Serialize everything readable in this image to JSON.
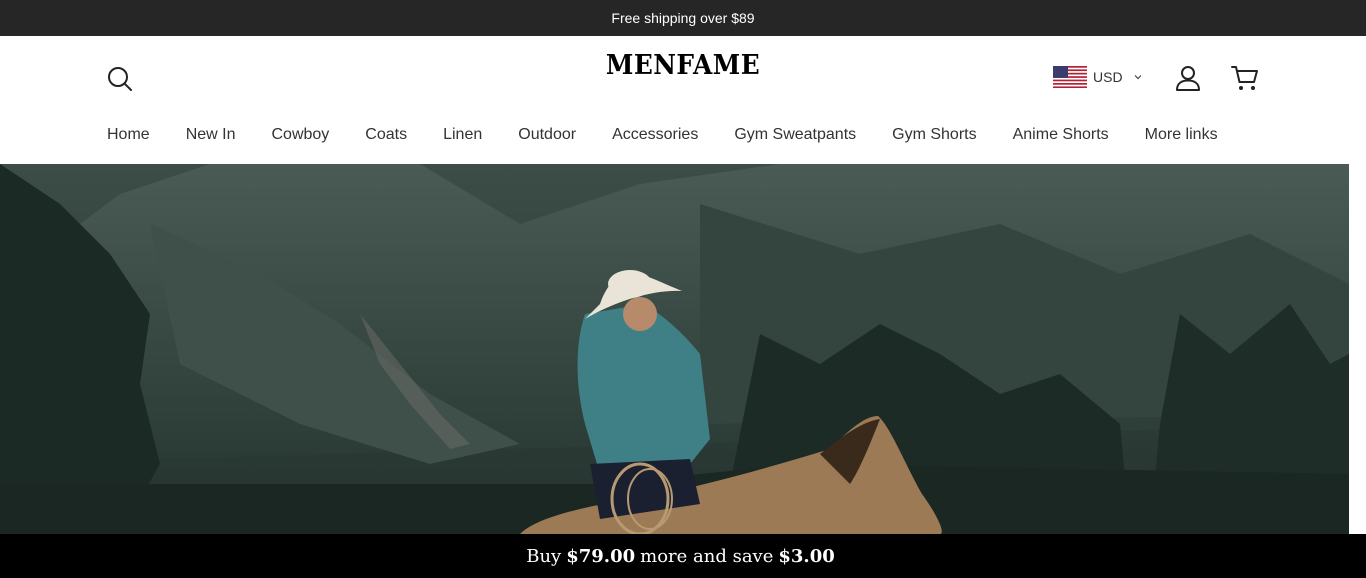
{
  "announcement": {
    "text": "Free shipping over $89"
  },
  "header": {
    "logo": "MENFAME",
    "currency": {
      "code": "USD"
    }
  },
  "nav": {
    "items": [
      "Home",
      "New In",
      "Cowboy",
      "Coats",
      "Linen",
      "Outdoor",
      "Accessories",
      "Gym Sweatpants",
      "Gym Shorts",
      "Anime Shorts",
      "More links"
    ]
  },
  "promo": {
    "prefix": "Buy",
    "amount": "$79.00",
    "middle": "more and save",
    "saving": "$3.00"
  },
  "colors": {
    "announcement_bg": "#262626",
    "promo_bg": "#000000",
    "text": "#333333"
  }
}
